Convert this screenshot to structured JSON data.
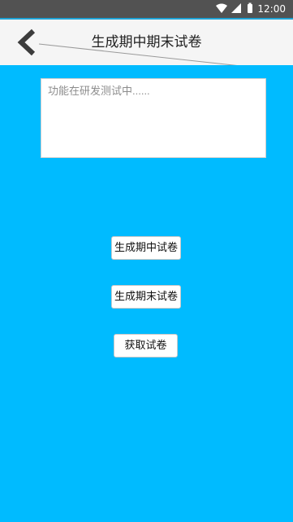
{
  "status_bar": {
    "time": "12:00",
    "icons": [
      "wifi-icon",
      "cellular-signal-icon",
      "battery-icon"
    ]
  },
  "header": {
    "back_icon": "chevron-left-icon",
    "title": "生成期中期末试卷"
  },
  "notice": {
    "placeholder": "功能在研发测试中......"
  },
  "actions": {
    "generate_midterm_label": "生成期中试卷",
    "generate_final_label": "生成期末试卷",
    "get_exam_label": "获取试卷"
  },
  "colors": {
    "background": "#00bbff",
    "status_bar": "#525252",
    "app_bar": "#f5f5f5",
    "button_bg": "#ffffff"
  }
}
